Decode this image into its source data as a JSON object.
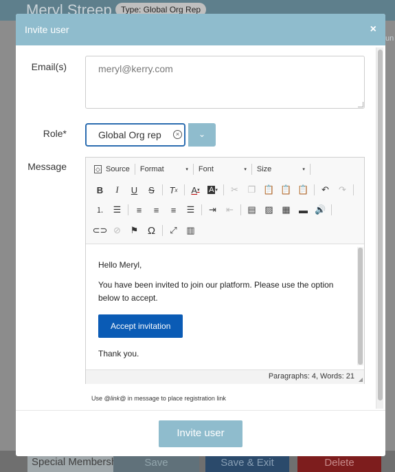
{
  "background": {
    "name": "Meryl Streep",
    "type_badge": "Type: Global Org Rep",
    "special_field": "Special Membersh",
    "save_label": "Save",
    "save_exit_label": "Save & Exit",
    "delete_label": "Delete",
    "right_edge_text": "un"
  },
  "modal": {
    "title": "Invite user",
    "close_glyph": "×",
    "email_label": "Email(s)",
    "email_value": "meryl@kerry.com",
    "role_label": "Role*",
    "role_value": "Global Org rep",
    "role_clear_glyph": "×",
    "role_dropdown_glyph": "⌄",
    "message_label": "Message",
    "toolbar": {
      "source_label": "Source",
      "format_label": "Format",
      "font_label": "Font",
      "size_label": "Size",
      "dropdown_arrow": "▾"
    },
    "message": {
      "greeting": "Hello Meryl,",
      "body": "You have been invited to join our platform. Please use the option below to accept.",
      "button_label": "Accept invitation",
      "closing": "Thank you."
    },
    "status": "Paragraphs: 4, Words: 21",
    "hint_prefix": "Use ",
    "hint_token": "@link@",
    "hint_suffix": " in message to place registration link",
    "invite_button": "Invite user"
  }
}
